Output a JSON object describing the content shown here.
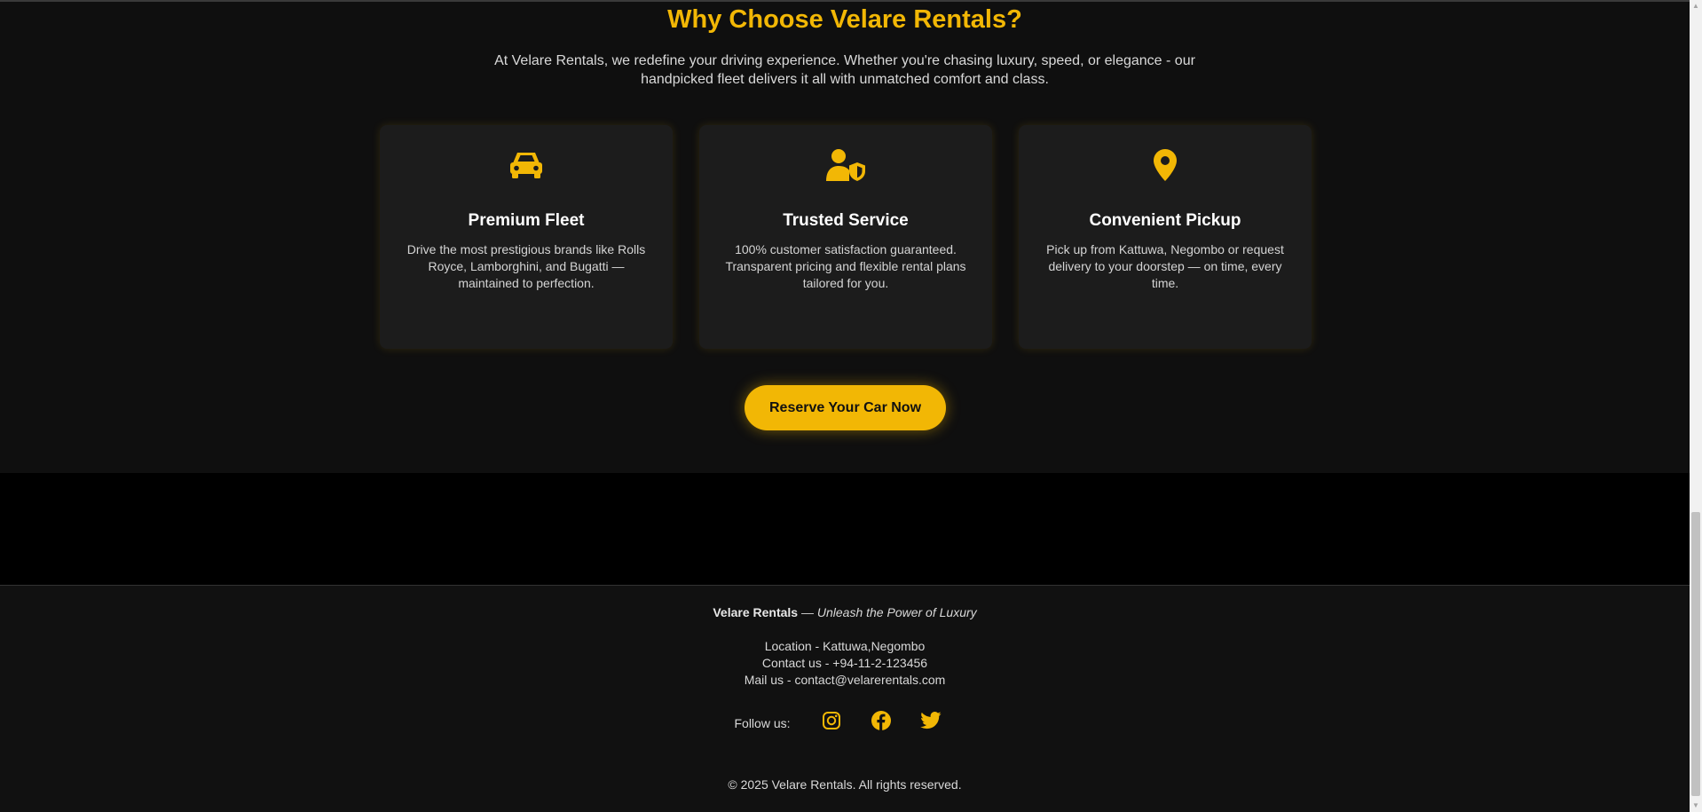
{
  "why_section": {
    "title": "Why Choose Velare Rentals?",
    "intro": "At Velare Rentals, we redefine your driving experience. Whether you're chasing luxury, speed, or elegance - our handpicked fleet delivers it all with unmatched comfort and class."
  },
  "features": [
    {
      "icon": "car-icon",
      "title": "Premium Fleet",
      "text": "Drive the most prestigious brands like Rolls Royce, Lamborghini, and Bugatti — maintained to perfection."
    },
    {
      "icon": "user-shield-icon",
      "title": "Trusted Service",
      "text": "100% customer satisfaction guaranteed. Transparent pricing and flexible rental plans tailored for you."
    },
    {
      "icon": "location-pin-icon",
      "title": "Convenient Pickup",
      "text": "Pick up from Kattuwa, Negombo or request delivery to your doorstep — on time, every time."
    }
  ],
  "cta": {
    "label": "Reserve Your Car Now"
  },
  "footer": {
    "brand": "Velare Rentals",
    "slogan": "— Unleash the Power of Luxury",
    "location": "Location - Kattuwa,Negombo",
    "contact": "Contact us - +94-11-2-123456",
    "mail": "Mail us - contact@velarerentals.com",
    "follow_label": "Follow us:",
    "social": [
      "instagram-icon",
      "facebook-icon",
      "twitter-icon"
    ],
    "copyright": "© 2025 Velare Rentals. All rights reserved."
  },
  "colors": {
    "accent": "#f2b705",
    "section_bg": "#0f0f0f",
    "card_bg": "#1c1c1c",
    "footer_bg": "#111111"
  }
}
